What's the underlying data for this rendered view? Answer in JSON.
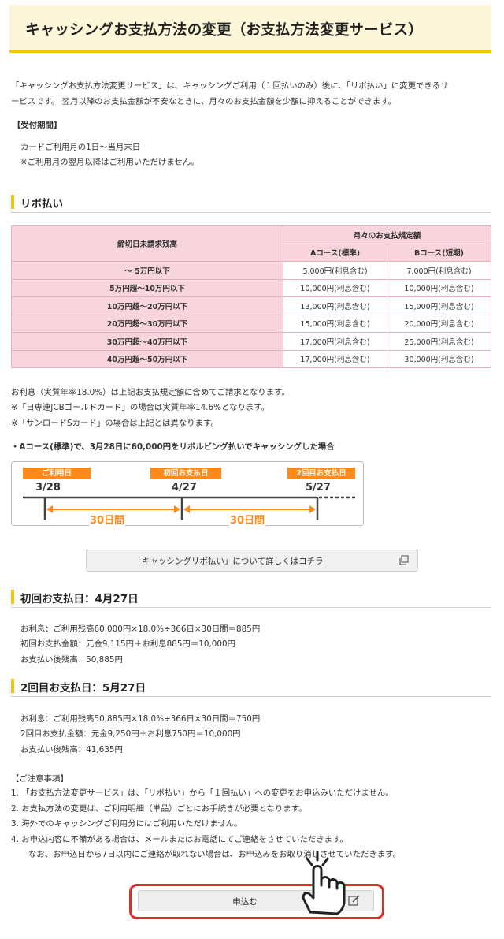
{
  "header": {
    "title": "キャッシングお支払方法の変更（お支払方法変更サービス）"
  },
  "intro": {
    "line1": "「キャッシングお支払方法変更サービス」は、キャッシングご利用（１回払いのみ）後に、「リボ払い」に変更できるサ",
    "line2": "ービスです。 翌月以降のお支払金額が不安なときに、月々のお支払金額を少額に抑えることができます。"
  },
  "period": {
    "heading": "【受付期間】",
    "line1": "カードご利用月の1日～当月末日",
    "line2": "※ご利用月の翌月以降はご利用いただけません。"
  },
  "revo": {
    "heading": "リボ払い",
    "table": {
      "col_balance": "締切日未請求残高",
      "col_group": "月々のお支払規定額",
      "col_a": "Aコース(標準)",
      "col_b": "Bコース(短期)",
      "rows": [
        {
          "balance": "～ 5万円以下",
          "a": "5,000円(利息含む)",
          "b": "7,000円(利息含む)"
        },
        {
          "balance": "5万円超～10万円以下",
          "a": "10,000円(利息含む)",
          "b": "10,000円(利息含む)"
        },
        {
          "balance": "10万円超～20万円以下",
          "a": "13,000円(利息含む)",
          "b": "15,000円(利息含む)"
        },
        {
          "balance": "20万円超～30万円以下",
          "a": "15,000円(利息含む)",
          "b": "20,000円(利息含む)"
        },
        {
          "balance": "30万円超～40万円以下",
          "a": "17,000円(利息含む)",
          "b": "25,000円(利息含む)"
        },
        {
          "balance": "40万円超～50万円以下",
          "a": "17,000円(利息含む)",
          "b": "30,000円(利息含む)"
        }
      ]
    },
    "notes": [
      "お利息（実質年率18.0%）は上記お支払規定額に含めてご請求となります。",
      "※「日専連JCBゴールドカード」の場合は実質年率14.6%となります。",
      "※「サンロードSカード」の場合は上記とは異なります。"
    ],
    "example_title": "・Aコース(標準)で、3月28日に60,000円をリボルビング払いでキャッシングした場合"
  },
  "timeline": {
    "label1": "ご利用日",
    "date1": "3/28",
    "label2": "初回お支払日",
    "date2": "4/27",
    "label3": "2回目お支払日",
    "date3": "5/27",
    "span1": "30日間",
    "span2": "30日間"
  },
  "detail_button": {
    "label": "「キャッシングリボ払い」について詳しくはコチラ"
  },
  "first_payment": {
    "heading": "初回お支払日：4月27日",
    "lines": [
      "お利息：ご利用残高60,000円×18.0%÷366日×30日間＝885円",
      "初回お支払金額：元金9,115円＋お利息885円＝10,000円",
      "お支払い後残高：50,885円"
    ]
  },
  "second_payment": {
    "heading": "2回目お支払日：5月27日",
    "lines": [
      "お利息：ご利用残高50,885円×18.0%÷366日×30日間＝750円",
      "2回目お支払金額：元金9,250円＋お利息750円＝10,000円",
      "お支払い後残高：41,635円"
    ]
  },
  "cautions": {
    "heading": "【ご注意事項】",
    "items": [
      "1. 「お支払方法変更サービス」は、「リボ払い」から「１回払い」への変更をお申込みいただけません。",
      "2. お支払方法の変更は、ご利用明細（単品）ごとにお手続きが必要となります。",
      "3. 海外でのキャッシングご利用分にはご利用いただけません。",
      "4. お申込内容に不備がある場合は、メールまたはお電話にてご連絡をさせていただきます。",
      "なお、お申込日から7日以内にご連絡が取れない場合は、お申込みをお取り消しさせていただきます。"
    ]
  },
  "apply_button": {
    "label": "申込む"
  },
  "colors": {
    "accent": "#f2c40c",
    "table_header": "#f8d4dc",
    "timeline": "#ff8a1a",
    "highlight": "#e02b2b"
  }
}
